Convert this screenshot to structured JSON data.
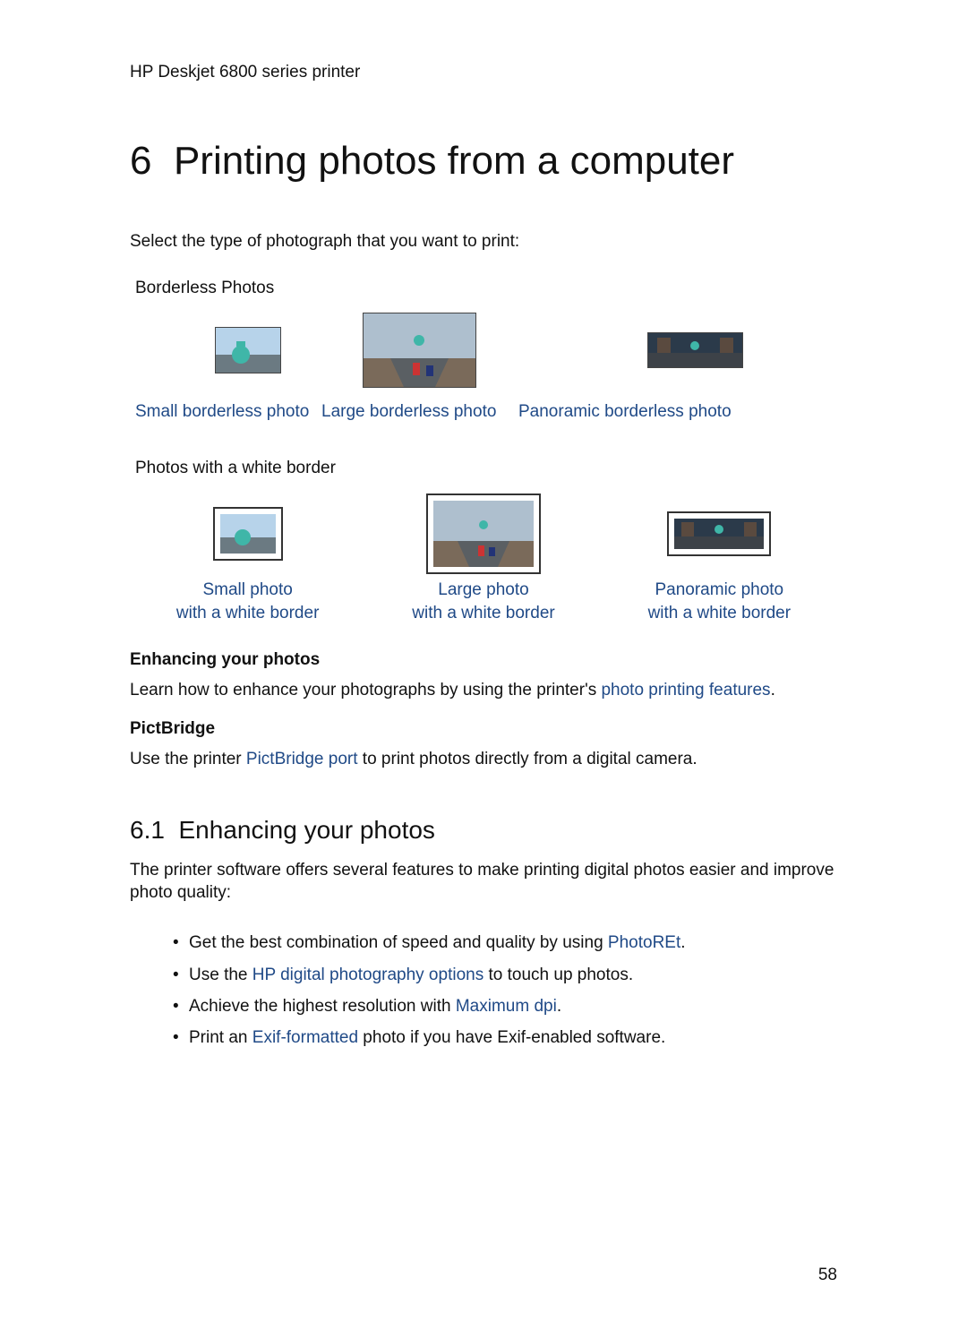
{
  "running_header": "HP Deskjet 6800 series printer",
  "chapter": {
    "number": "6",
    "title": "Printing photos from a computer"
  },
  "intro": "Select the type of photograph that you want to print:",
  "section_borderless": {
    "label": "Borderless Photos",
    "items": [
      {
        "caption": "Small borderless photo"
      },
      {
        "caption": "Large borderless photo"
      },
      {
        "caption": "Panoramic borderless photo"
      }
    ]
  },
  "section_whiteborder": {
    "label": "Photos with a white border",
    "items": [
      {
        "line1": "Small photo",
        "line2": "with a white border"
      },
      {
        "line1": "Large photo",
        "line2": "with a white border"
      },
      {
        "line1": "Panoramic photo",
        "line2": "with a white border"
      }
    ]
  },
  "enhance": {
    "heading": "Enhancing your photos",
    "text_before": "Learn how to enhance your photographs by using the printer's ",
    "link": "photo printing features",
    "text_after": "."
  },
  "pictbridge": {
    "heading": "PictBridge",
    "text_before": "Use the printer ",
    "link": "PictBridge port",
    "text_after": " to print photos directly from a digital camera."
  },
  "h2": {
    "number": "6.1",
    "title": "Enhancing your photos"
  },
  "h2_intro": "The printer software offers several features to make printing digital photos easier and improve photo quality:",
  "bullets": [
    {
      "before": "Get the best combination of speed and quality by using ",
      "link": "PhotoREt",
      "after": "."
    },
    {
      "before": "Use the ",
      "link": "HP digital photography options",
      "after": " to touch up photos."
    },
    {
      "before": "Achieve the highest resolution with ",
      "link": "Maximum dpi",
      "after": "."
    },
    {
      "before": "Print an ",
      "link": "Exif-formatted",
      "after": " photo if you have Exif-enabled software."
    }
  ],
  "page_number": "58"
}
